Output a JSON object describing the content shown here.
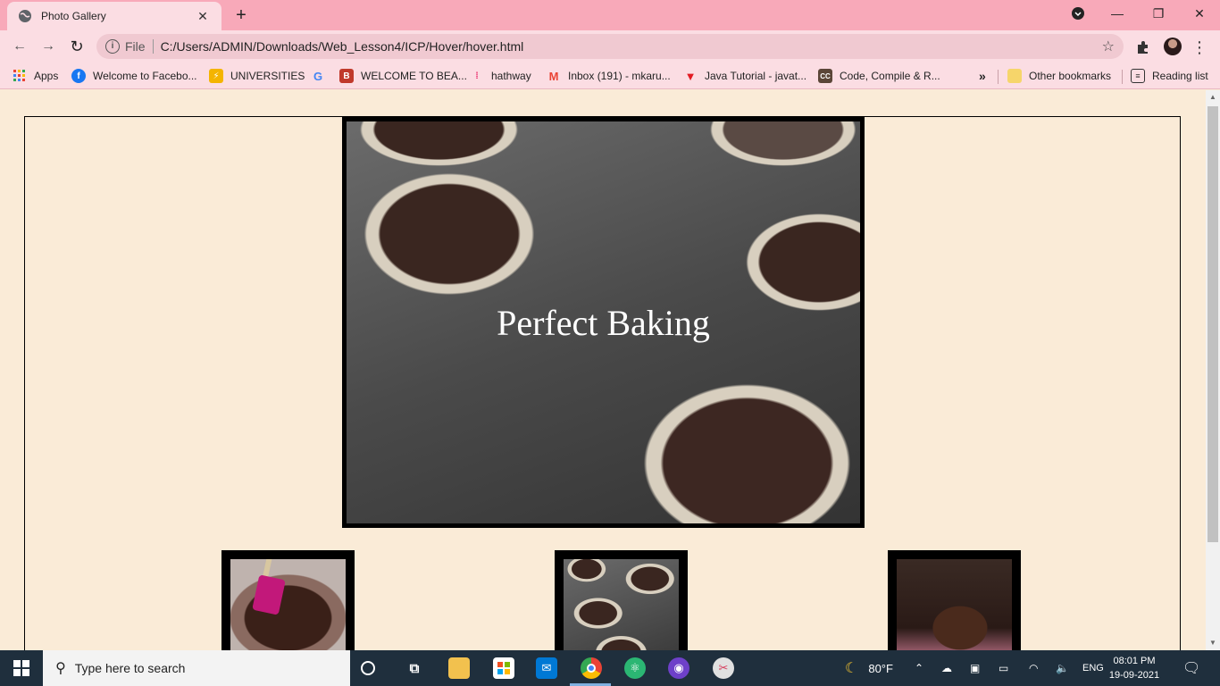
{
  "browser": {
    "tab": {
      "title": "Photo Gallery",
      "close": "✕"
    },
    "new_tab": "+",
    "window": {
      "minimize": "—",
      "restore": "❐",
      "close": "✕"
    },
    "nav": {
      "back": "←",
      "forward": "→",
      "reload": "↻"
    },
    "omnibox": {
      "info": "i",
      "scheme": "File",
      "url": "C:/Users/ADMIN/Downloads/Web_Lesson4/ICP/Hover/hover.html",
      "star": "☆"
    },
    "bookmarks": [
      {
        "label": "Apps",
        "icon": "apps-grid-icon"
      },
      {
        "label": "Welcome to Facebo...",
        "icon": "facebook-icon"
      },
      {
        "label": "UNIVERSITIES",
        "icon": "universities-icon"
      },
      {
        "label": "",
        "icon": "google-icon"
      },
      {
        "label": "WELCOME TO BEA...",
        "icon": "bea-icon"
      },
      {
        "label": "hathway",
        "icon": "hathway-icon"
      },
      {
        "label": "Inbox (191) - mkaru...",
        "icon": "gmail-icon"
      },
      {
        "label": "Java Tutorial - javat...",
        "icon": "javatpoint-icon"
      },
      {
        "label": "Code, Compile & R...",
        "icon": "codechef-icon"
      }
    ],
    "bookmarks_more": "»",
    "other_bookmarks": "Other bookmarks",
    "reading_list": "Reading list"
  },
  "gallery": {
    "hero_caption": "Perfect Baking"
  },
  "taskbar": {
    "search_placeholder": "Type here to search",
    "weather": "80°F",
    "language": "ENG",
    "time": "08:01 PM",
    "date": "19-09-2021"
  },
  "colors": {
    "tab_strip": "#f8a9b9",
    "toolbar": "#fbdde3",
    "page_background": "#faebd7",
    "frame_border": "#000000",
    "taskbar": "#1f2f3d"
  }
}
